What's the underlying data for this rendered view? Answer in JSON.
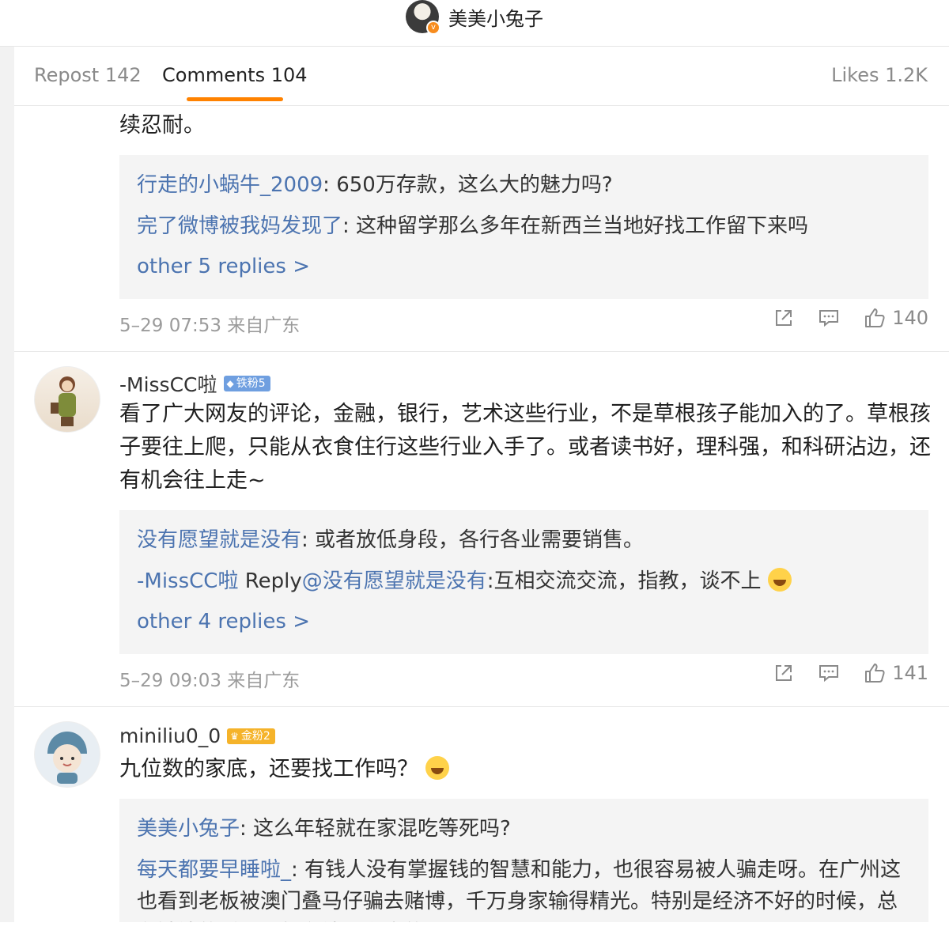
{
  "header": {
    "owner_name": "美美小兔子",
    "verified_badge": "v"
  },
  "tabs": {
    "repost": "Repost 142",
    "comments": "Comments 104",
    "likes": "Likes 1.2K"
  },
  "comments": [
    {
      "text_tail": "续忍耐。",
      "replies": [
        {
          "user": "行走的小蜗牛_2009",
          "text": ": 650万存款，这么大的魅力吗?"
        },
        {
          "user": "完了微博被我妈发现了",
          "text": ": 这种留学那么多年在新西兰当地好找工作留下来吗"
        }
      ],
      "more": "other 5 replies >",
      "time": "5–29 07:53 来自广东",
      "likes": "140"
    },
    {
      "author": "-MissCC啦",
      "badge": "铁粉5",
      "text": "看了广大网友的评论，金融，银行，艺术这些行业，不是草根孩子能加入的了。草根孩子要往上爬，只能从衣食住行这些行业入手了。或者读书好，理科强，和科研沾边，还有机会往上走~",
      "replies": [
        {
          "user": "没有愿望就是没有",
          "text": ": 或者放低身段，各行各业需要销售。"
        },
        {
          "user": "-MissCC啦",
          "mid": " Reply",
          "mention": "@没有愿望就是没有",
          "text": ":互相交流交流，指教，谈不上"
        }
      ],
      "more": "other 4 replies >",
      "time": "5–29 09:03 来自广东",
      "likes": "141"
    },
    {
      "author": "miniliu0_0",
      "badge": "金粉2",
      "text": "九位数的家底，还要找工作吗？",
      "replies": [
        {
          "user": "美美小兔子",
          "text": ": 这么年轻就在家混吃等死吗?"
        },
        {
          "user": "每天都要早睡啦_",
          "text": ": 有钱人没有掌握钱的智慧和能力，也很容易被人骗走呀。在广州这也看到老板被澳门叠马仔骗去赌博，千万身家输得精光。特别是经济不好的时候，总有缺钱的聪明人打有钱人主意的。"
        }
      ]
    }
  ],
  "icons": [
    "share-icon",
    "comment-icon",
    "like-icon",
    "laugh-cry-emoji",
    "cry-emoji"
  ],
  "colors": {
    "accent": "#ff8200",
    "link": "#4c74b0",
    "reply_bg": "#f4f4f4",
    "iron_badge": "#6f9fe0",
    "gold_badge": "#f5b32a"
  }
}
